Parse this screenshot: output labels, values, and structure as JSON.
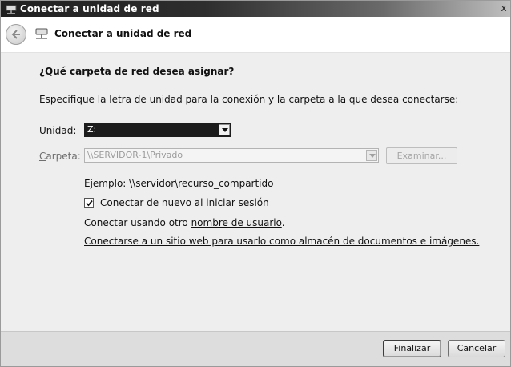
{
  "window": {
    "title": "Conectar a unidad de red",
    "close_glyph": "x"
  },
  "nav": {
    "title": "Conectar a unidad de red",
    "back_icon": "back-arrow-icon",
    "wizard_icon": "network-drive-icon"
  },
  "content": {
    "heading": "¿Qué carpeta de red desea asignar?",
    "description": "Especifique la letra de unidad para la conexión y la carpeta a la que desea conectarse:",
    "unidad": {
      "label": "Unidad:",
      "value": "Z:"
    },
    "carpeta": {
      "label": "Carpeta:",
      "value": "\\\\SERVIDOR-1\\Privado",
      "browse_label": "Examinar..."
    },
    "example": "Ejemplo: \\\\servidor\\recurso_compartido",
    "reconnect": {
      "label": "Conectar de nuevo al iniciar sesión",
      "checked": true
    },
    "other_user": {
      "prefix": "Conectar usando otro ",
      "link": "nombre de usuario",
      "suffix": "."
    },
    "web_link": "Conectarse a un sitio web para usarlo como almacén de documentos e imágenes."
  },
  "footer": {
    "finish_label": "Finalizar",
    "cancel_label": "Cancelar"
  }
}
